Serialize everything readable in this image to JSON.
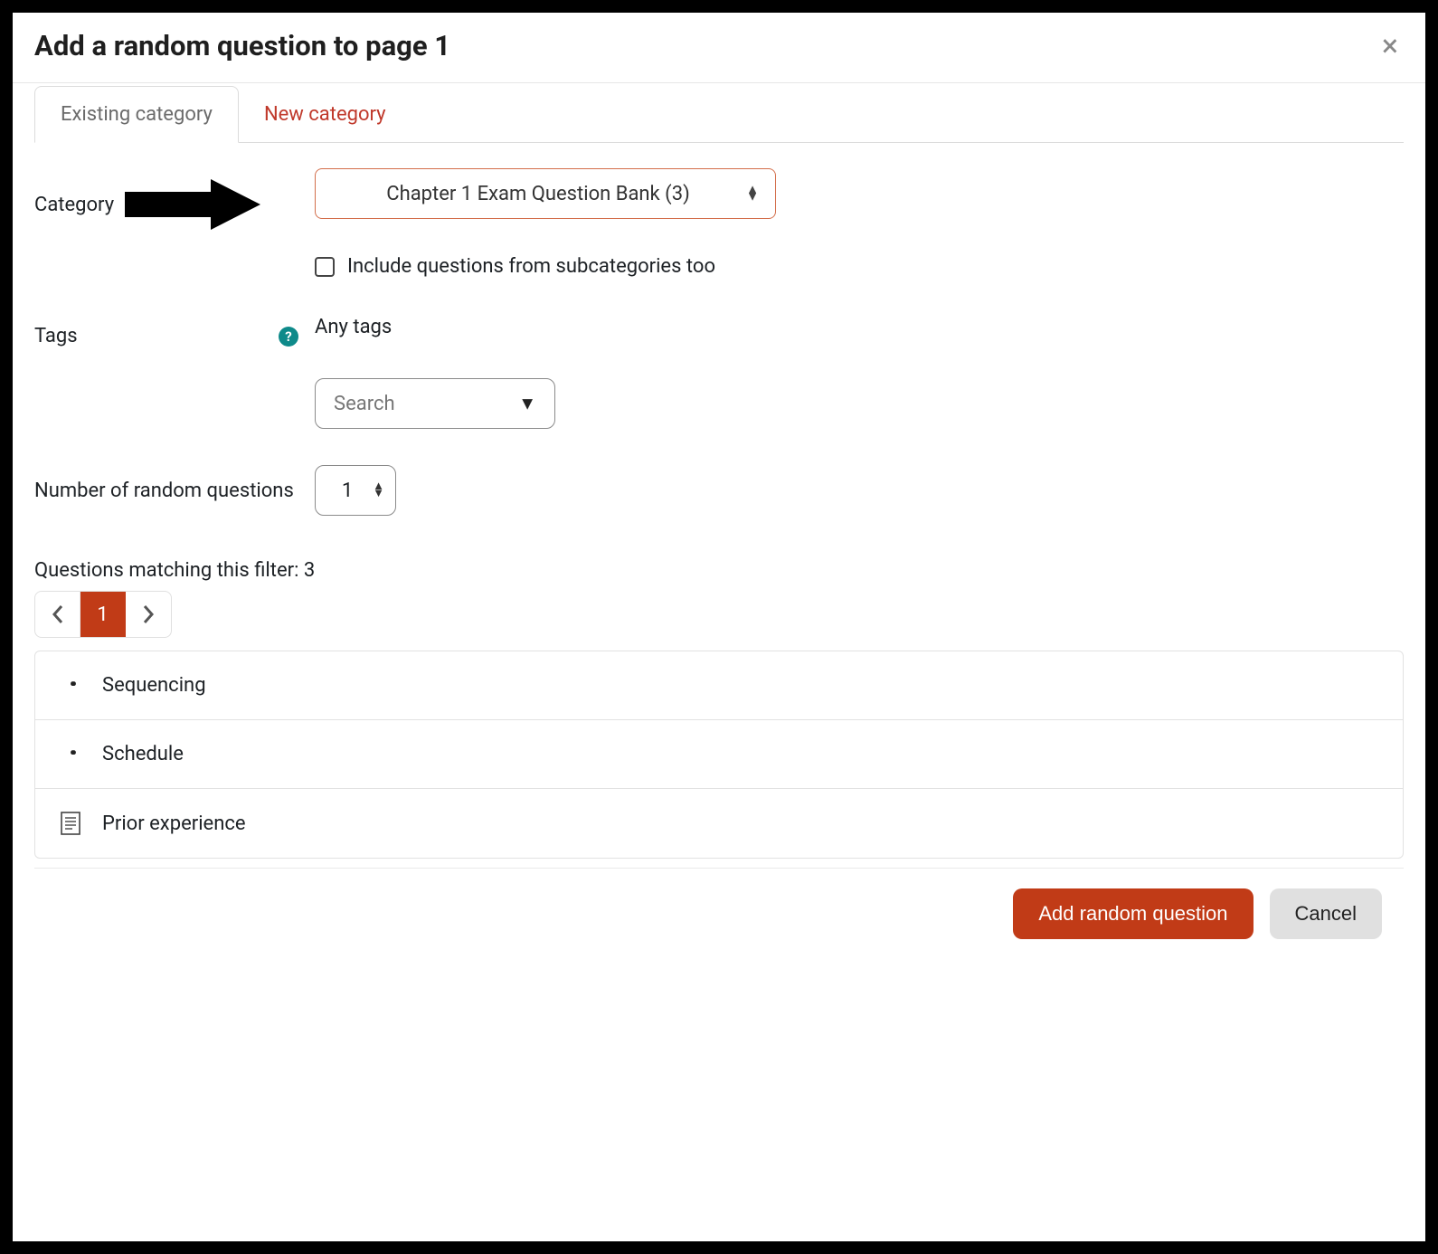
{
  "dialog": {
    "title": "Add a random question to page 1",
    "close_label": "×"
  },
  "tabs": {
    "existing": "Existing category",
    "newcat": "New category"
  },
  "form": {
    "category_label": "Category",
    "category_value": "Chapter 1 Exam Question Bank (3)",
    "include_sub_label": "Include questions from subcategories too",
    "tags_label": "Tags",
    "any_tags_label": "Any tags",
    "search_placeholder": "Search",
    "num_label": "Number of random questions",
    "num_value": "1"
  },
  "filter": {
    "label_prefix": "Questions matching this filter: ",
    "count": "3",
    "page": "1"
  },
  "questions": [
    {
      "name": "Sequencing",
      "icon": "dots"
    },
    {
      "name": "Schedule",
      "icon": "dots"
    },
    {
      "name": "Prior experience",
      "icon": "doc"
    }
  ],
  "footer": {
    "primary": "Add random question",
    "cancel": "Cancel"
  }
}
